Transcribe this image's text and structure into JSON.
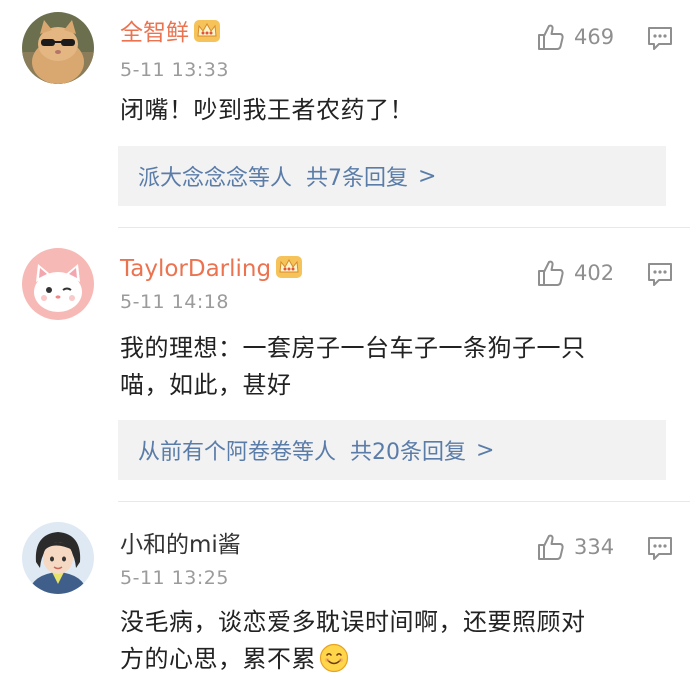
{
  "comments": [
    {
      "username": "全智鲜",
      "time": "5-11 13:33",
      "likes": "469",
      "text": "闭嘴！吵到我王者农药了！",
      "reply_users": "派大念念念等人",
      "reply_count": "共7条回复",
      "reply_chevron": ">",
      "vip": true
    },
    {
      "username": "TaylorDarling",
      "time": "5-11 14:18",
      "likes": "402",
      "text_line1": "我的理想：一套房子一台车子一条狗子一只",
      "text_line2": "喵，如此，甚好",
      "reply_users": "从前有个阿卷卷等人",
      "reply_count": "共20条回复",
      "reply_chevron": ">",
      "vip": true
    },
    {
      "username": "小和的mi酱",
      "time": "5-11 13:25",
      "likes": "334",
      "text_line1": "没毛病，谈恋爱多耽误时间啊，还要照顾对",
      "text_line2": "方的心思，累不累",
      "vip": false
    }
  ],
  "icons": {
    "like": "thumbs-up-icon",
    "reply": "comment-icon",
    "vip": "crown-icon",
    "emoji": "smile-emoji"
  },
  "colors": {
    "vip_name": "#eb7350",
    "normal_name": "#333333",
    "link": "#5a7ca8",
    "meta": "#9b9b9b",
    "reply_bg": "#f2f2f2"
  }
}
